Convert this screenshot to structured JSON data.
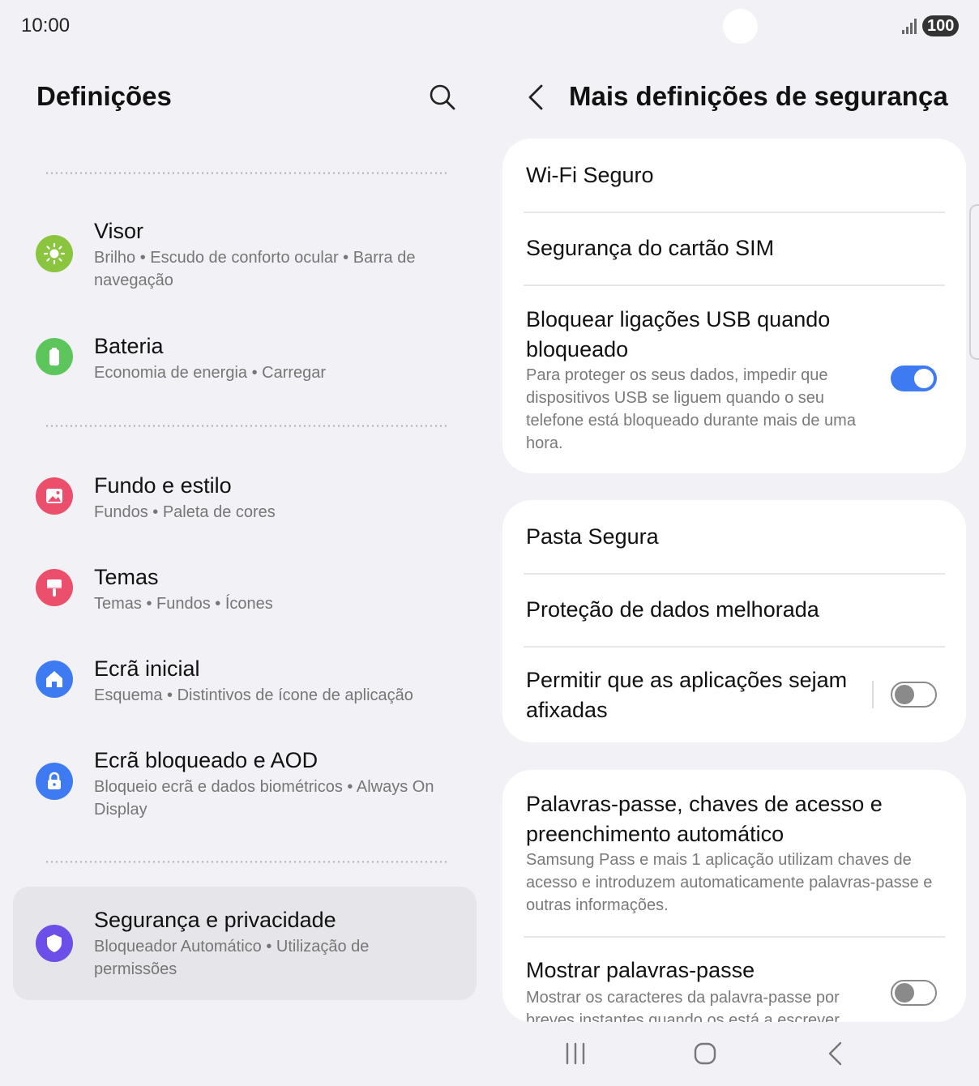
{
  "status": {
    "time": "10:00",
    "battery": "100"
  },
  "left": {
    "title": "Definições",
    "items": [
      {
        "title": "Visor",
        "subtitle": "Brilho • Escudo de conforto ocular • Barra de navegação",
        "icon": "sun-icon",
        "color": "#8bc53f"
      },
      {
        "title": "Bateria",
        "subtitle": "Economia de energia • Carregar",
        "icon": "battery-icon",
        "color": "#5cc55c"
      },
      {
        "title": "Fundo e estilo",
        "subtitle": "Fundos • Paleta de cores",
        "icon": "image-icon",
        "color": "#ec4f6b"
      },
      {
        "title": "Temas",
        "subtitle": "Temas • Fundos • Ícones",
        "icon": "paintbrush-icon",
        "color": "#ec4f6b"
      },
      {
        "title": "Ecrã inicial",
        "subtitle": "Esquema • Distintivos de ícone de aplicação",
        "icon": "home-icon",
        "color": "#3e7bf3"
      },
      {
        "title": "Ecrã bloqueado e AOD",
        "subtitle": "Bloqueio ecrã e dados biométricos • Always On Display",
        "icon": "lock-icon",
        "color": "#3e7bf3"
      },
      {
        "title": "Segurança e privacidade",
        "subtitle": "Bloqueador Automático • Utilização de permissões",
        "icon": "shield-icon",
        "color": "#6c4ee8"
      }
    ]
  },
  "right": {
    "title": "Mais definições de segurança",
    "card1": {
      "wifi": "Wi-Fi Seguro",
      "sim": "Segurança do cartão SIM",
      "usb_title": "Bloquear ligações USB quando bloqueado",
      "usb_sub": "Para proteger os seus dados, impedir que dispositivos USB se liguem quando o seu telefone está bloqueado durante mais de uma hora.",
      "usb_on": true
    },
    "card2": {
      "folder": "Pasta Segura",
      "data": "Proteção de dados melhorada",
      "pin_title": "Permitir que as aplicações sejam afixadas",
      "pin_on": false
    },
    "card3": {
      "pw_title": "Palavras-passe, chaves de acesso e preenchimento automático",
      "pw_sub": "Samsung Pass e mais 1 aplicação utilizam chaves de acesso e introduzem automaticamente palavras-passe e outras informações.",
      "show_title": "Mostrar palavras-passe",
      "show_sub": "Mostrar os caracteres da palavra-passe por breves instantes quando os está a escrever.",
      "show_on": false
    }
  },
  "accent": "#3e7bf3"
}
